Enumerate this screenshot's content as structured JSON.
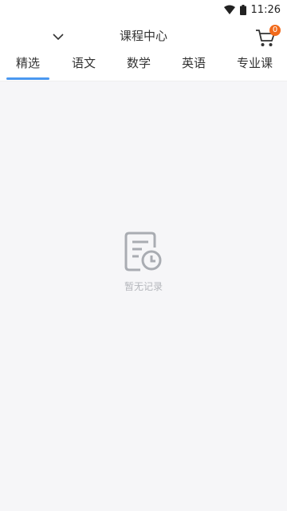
{
  "status_bar": {
    "time": "11:26",
    "wifi_icon": "wifi-icon",
    "battery_icon": "battery-icon"
  },
  "header": {
    "title": "课程中心",
    "dropdown_icon": "chevron-down-icon",
    "cart": {
      "icon": "cart-icon",
      "badge_count": "0",
      "badge_color": "#f26a1b"
    }
  },
  "tabs": [
    {
      "label": "精选",
      "active": true
    },
    {
      "label": "语文",
      "active": false
    },
    {
      "label": "数学",
      "active": false
    },
    {
      "label": "英语",
      "active": false
    },
    {
      "label": "专业课",
      "active": false
    }
  ],
  "accent_color": "#4a98f0",
  "empty_state": {
    "icon": "document-clock-icon",
    "text": "暂无记录"
  }
}
